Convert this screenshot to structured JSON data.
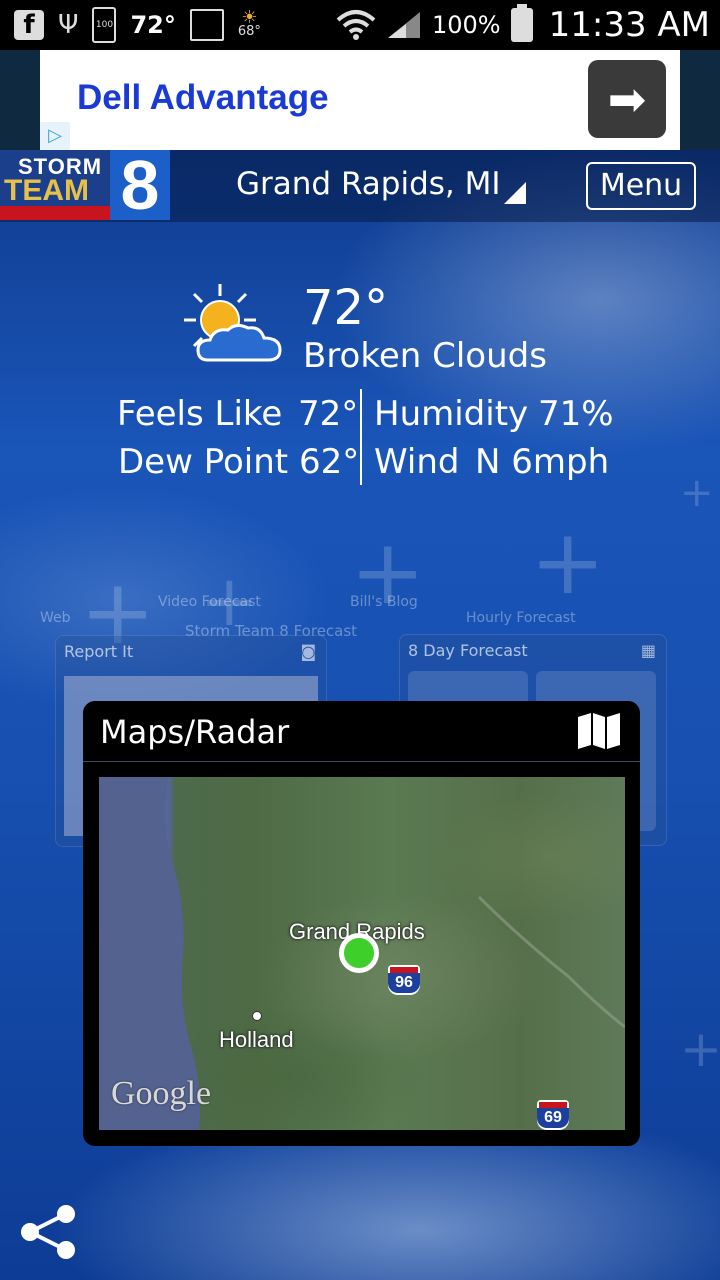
{
  "status_bar": {
    "temp": "72°",
    "weather_temp": "68°",
    "battery_icon_label": "100",
    "battery_pct": "100%",
    "time": "11:33 AM"
  },
  "ad": {
    "title": "Dell Advantage",
    "icons": {
      "arrow": "arrow-right-icon",
      "choices": "adchoices-icon"
    }
  },
  "header": {
    "logo_storm": "STORM",
    "logo_team": "TEAM",
    "logo_number": "8",
    "city": "Grand Rapids, MI",
    "menu_label": "Menu"
  },
  "current": {
    "temp": "72°",
    "condition": "Broken Clouds",
    "feels_like_label": "Feels Like",
    "feels_like_value": "72°",
    "humidity_label": "Humidity",
    "humidity_value": "71%",
    "dew_point_label": "Dew Point",
    "dew_point_value": "62°",
    "wind_label": "Wind",
    "wind_value": "N 6mph"
  },
  "background_cards": {
    "web": "Web",
    "video_forecast": "Video Forecast",
    "bills_blog": "Bill's Blog",
    "hourly_forecast": "Hourly Forecast",
    "storm_team_forecast": "Storm Team 8 Forecast",
    "report_it": "Report It",
    "eight_day": "8 Day Forecast"
  },
  "maps_card": {
    "title": "Maps/Radar",
    "labels": {
      "grand_rapids": "Grand Rapids",
      "holland": "Holland",
      "google": "Google",
      "i96": "96",
      "i69": "69"
    }
  },
  "colors": {
    "ad_title": "#1a3ad6",
    "pin": "#3ecf2a",
    "logo_red": "#c8141e",
    "logo_blue": "#1c5fc9"
  }
}
